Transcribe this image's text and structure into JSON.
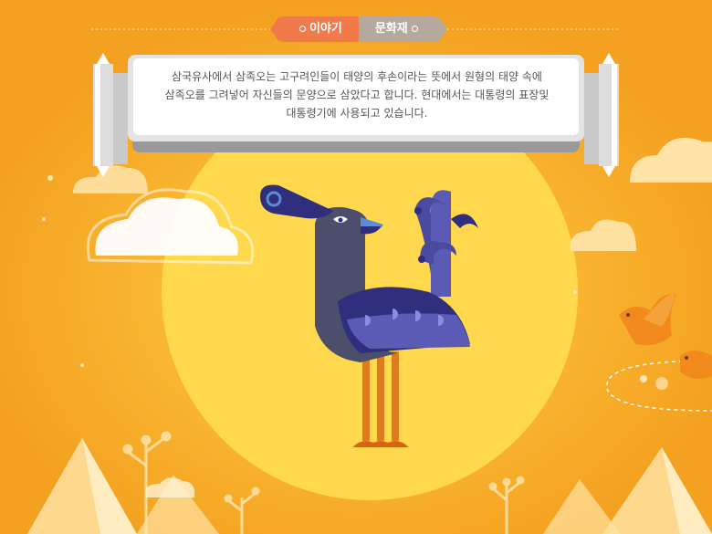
{
  "tabs": [
    {
      "label": "이야기",
      "active": true
    },
    {
      "label": "문화재",
      "active": false
    }
  ],
  "description": {
    "line1": "삼국유사에서 삼족오는 고구려인들이 태양의 후손이라는 뜻에서 원형의 태양 속에",
    "line2": "삼족오를 그려넣어 자신들의 문양으로 삼았다고 합니다. 현대에서는 대통령의 표장및",
    "line3": "대통령기에 사용되고 있습니다."
  },
  "colors": {
    "background": "#f7a823",
    "sun": "#ffd84e",
    "bird_body": "#4b4f6b",
    "bird_wing": "#2f2f7e",
    "bird_feather": "#5b5bb6",
    "legs": "#e07a1e"
  }
}
